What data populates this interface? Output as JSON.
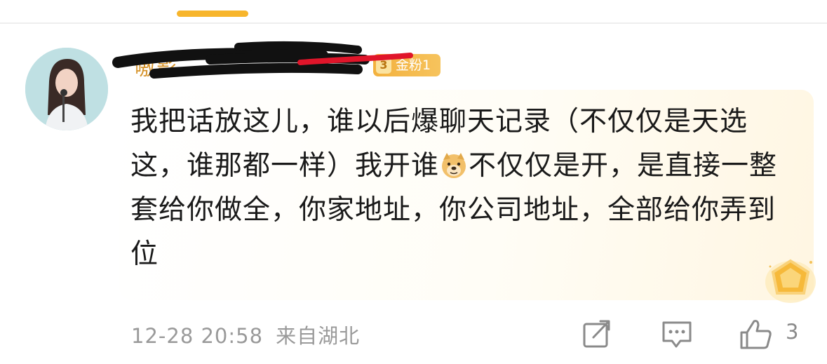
{
  "comment": {
    "username": "嗷影",
    "fan_badge": {
      "level": "3",
      "label": "金粉1"
    },
    "text_before_emoji": "我把话放这儿，谁以后爆聊天记录（不仅仅是天选这，谁那都一样）我开谁",
    "emoji": "doge-emoji",
    "text_after_emoji": "不仅仅是开，是直接一整套给你做全，你家地址，你公司地址，全部给你弄到位",
    "timestamp": "12-28 20:58",
    "location": "来自湖北",
    "like_count": "3"
  },
  "icons": [
    "share-icon",
    "reply-icon",
    "like-icon",
    "medal-icon"
  ],
  "colors": {
    "accent": "#f7b52c",
    "username": "#d6932a",
    "badge": "#f3b13d",
    "meta": "#9a9a9a",
    "text": "#1a1a1a"
  }
}
